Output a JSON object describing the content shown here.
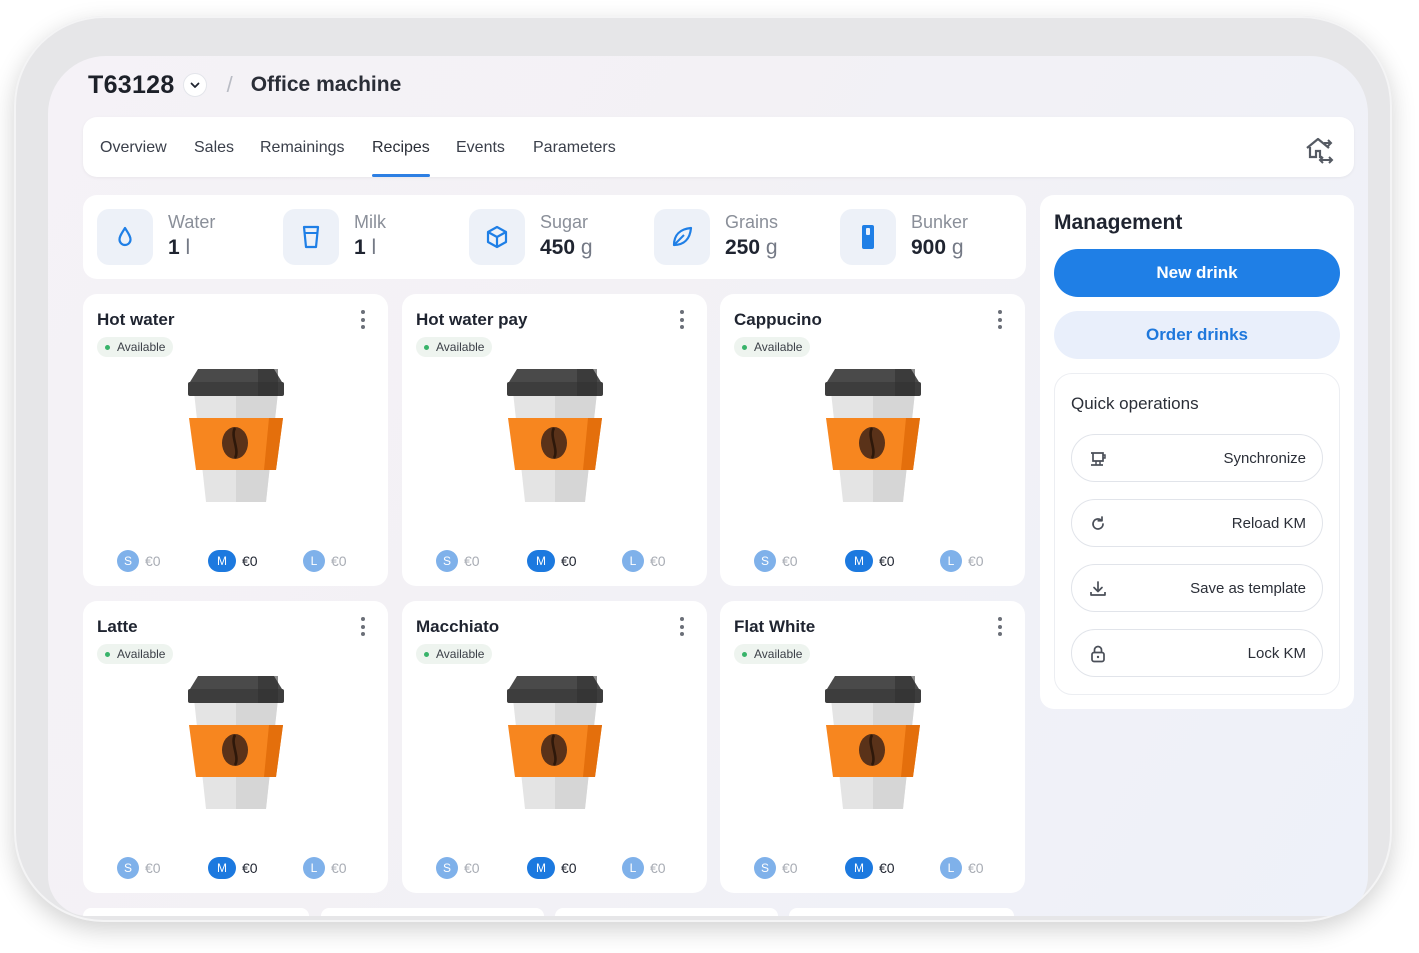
{
  "header": {
    "machine_id": "T63128",
    "separator": "/",
    "machine_name": "Office machine"
  },
  "tabs": [
    {
      "label": "Overview"
    },
    {
      "label": "Sales"
    },
    {
      "label": "Remainings"
    },
    {
      "label": "Recipes",
      "active": true
    },
    {
      "label": "Events"
    },
    {
      "label": "Parameters"
    }
  ],
  "stats": [
    {
      "label": "Water",
      "value": "1",
      "unit": "l",
      "icon": "water-drop-icon"
    },
    {
      "label": "Milk",
      "value": "1",
      "unit": "l",
      "icon": "glass-icon"
    },
    {
      "label": "Sugar",
      "value": "450",
      "unit": "g",
      "icon": "cube-icon"
    },
    {
      "label": "Grains",
      "value": "250",
      "unit": "g",
      "icon": "leaf-icon"
    },
    {
      "label": "Bunker",
      "value": "900",
      "unit": "g",
      "icon": "bunker-icon"
    }
  ],
  "drinks": [
    {
      "name": "Hot water",
      "status": "Available",
      "sizes": [
        {
          "size": "S",
          "price": "€0"
        },
        {
          "size": "M",
          "price": "€0"
        },
        {
          "size": "L",
          "price": "€0"
        }
      ]
    },
    {
      "name": "Hot water pay",
      "status": "Available",
      "sizes": [
        {
          "size": "S",
          "price": "€0"
        },
        {
          "size": "M",
          "price": "€0"
        },
        {
          "size": "L",
          "price": "€0"
        }
      ]
    },
    {
      "name": "Cappucino",
      "status": "Available",
      "sizes": [
        {
          "size": "S",
          "price": "€0"
        },
        {
          "size": "M",
          "price": "€0"
        },
        {
          "size": "L",
          "price": "€0"
        }
      ]
    },
    {
      "name": "Latte",
      "status": "Available",
      "sizes": [
        {
          "size": "S",
          "price": "€0"
        },
        {
          "size": "M",
          "price": "€0"
        },
        {
          "size": "L",
          "price": "€0"
        }
      ]
    },
    {
      "name": "Macchiato",
      "status": "Available",
      "sizes": [
        {
          "size": "S",
          "price": "€0"
        },
        {
          "size": "M",
          "price": "€0"
        },
        {
          "size": "L",
          "price": "€0"
        }
      ]
    },
    {
      "name": "Flat White",
      "status": "Available",
      "sizes": [
        {
          "size": "S",
          "price": "€0"
        },
        {
          "size": "M",
          "price": "€0"
        },
        {
          "size": "L",
          "price": "€0"
        }
      ]
    }
  ],
  "selected_size": "M",
  "management": {
    "title": "Management",
    "new_drink": "New drink",
    "order_drinks": "Order drinks",
    "quick_title": "Quick operations",
    "quick": [
      {
        "label": "Synchronize",
        "icon": "coffee-machine-icon"
      },
      {
        "label": "Reload KM",
        "icon": "reload-icon"
      },
      {
        "label": "Save as template",
        "icon": "download-icon"
      },
      {
        "label": "Lock KM",
        "icon": "lock-icon"
      }
    ]
  },
  "colors": {
    "accent": "#1f7fe6",
    "status_ok": "#38b36a",
    "cup_orange": "#f7861f"
  }
}
